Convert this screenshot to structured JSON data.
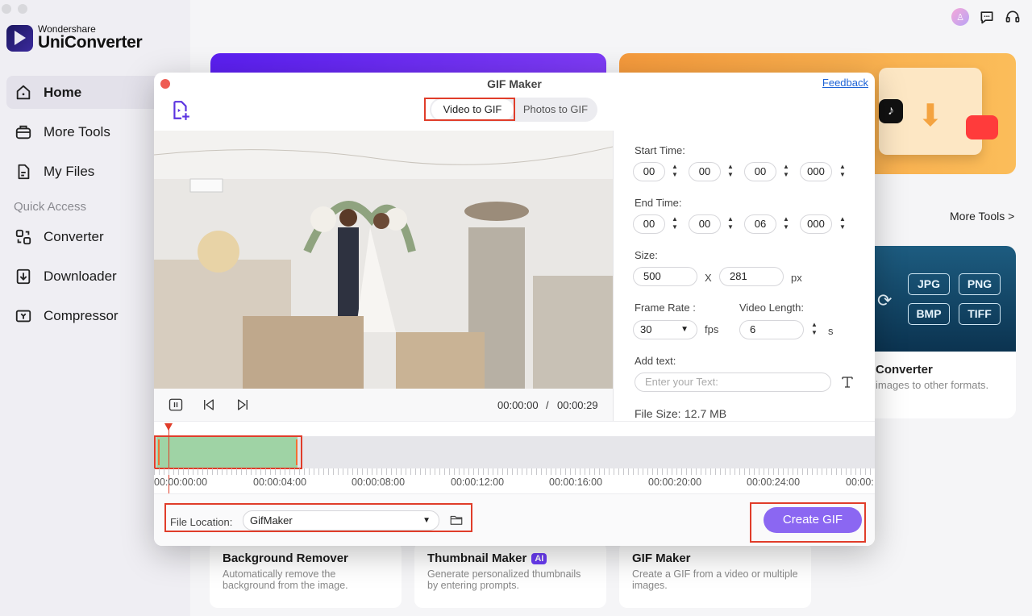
{
  "app": {
    "brand_small": "Wondershare",
    "brand_big": "UniConverter"
  },
  "sidebar": {
    "items": [
      {
        "label": "Home"
      },
      {
        "label": "More Tools"
      },
      {
        "label": "My Files"
      }
    ],
    "quick_access": "Quick Access",
    "quick_items": [
      {
        "label": "Converter"
      },
      {
        "label": "Downloader"
      },
      {
        "label": "Compressor"
      }
    ]
  },
  "header": {
    "avatar": "♙"
  },
  "home": {
    "more_tools_link": "More Tools >",
    "image_converter": {
      "title": "Converter",
      "desc": "images to other formats.",
      "formats": [
        "JPG",
        "PNG",
        "BMP",
        "TIFF"
      ]
    },
    "tools": [
      {
        "title": "Background Remover",
        "desc": "Automatically remove the background from the image.",
        "ai": ""
      },
      {
        "title": "Thumbnail Maker",
        "desc": "Generate personalized thumbnails by entering prompts.",
        "ai": "AI"
      },
      {
        "title": "GIF Maker",
        "desc": "Create a GIF from a video or multiple images.",
        "ai": ""
      }
    ]
  },
  "dialog": {
    "title": "GIF Maker",
    "feedback": "Feedback",
    "tabs": [
      "Video to GIF",
      "Photos to GIF"
    ],
    "player": {
      "current": "00:00:00",
      "separator": "/",
      "total": "00:00:29"
    },
    "start_time": {
      "label": "Start Time:",
      "h": "00",
      "m": "00",
      "s": "00",
      "ms": "000"
    },
    "end_time": {
      "label": "End Time:",
      "h": "00",
      "m": "00",
      "s": "06",
      "ms": "000"
    },
    "size": {
      "label": "Size:",
      "width": "500",
      "x": "X",
      "height": "281",
      "unit": "px"
    },
    "frame_rate": {
      "label": "Frame Rate :",
      "value": "30",
      "unit": "fps"
    },
    "video_length": {
      "label": "Video Length:",
      "value": "6",
      "unit": "s"
    },
    "add_text": {
      "label": "Add text:",
      "placeholder": "Enter your Text:"
    },
    "file_size": {
      "label": "File Size:",
      "value": "12.7 MB"
    },
    "timeline_labels": [
      "00:00:00:00",
      "00:00:04:00",
      "00:00:08:00",
      "00:00:12:00",
      "00:00:16:00",
      "00:00:20:00",
      "00:00:24:00",
      "00:00:"
    ],
    "file_location": {
      "label": "File Location:",
      "value": "GifMaker"
    },
    "create_button": "Create GIF"
  },
  "colors": {
    "accent": "#8b67f2",
    "highlight": "#e03d2a",
    "selection": "#9fd3a5",
    "feedback": "#1d63d6"
  }
}
